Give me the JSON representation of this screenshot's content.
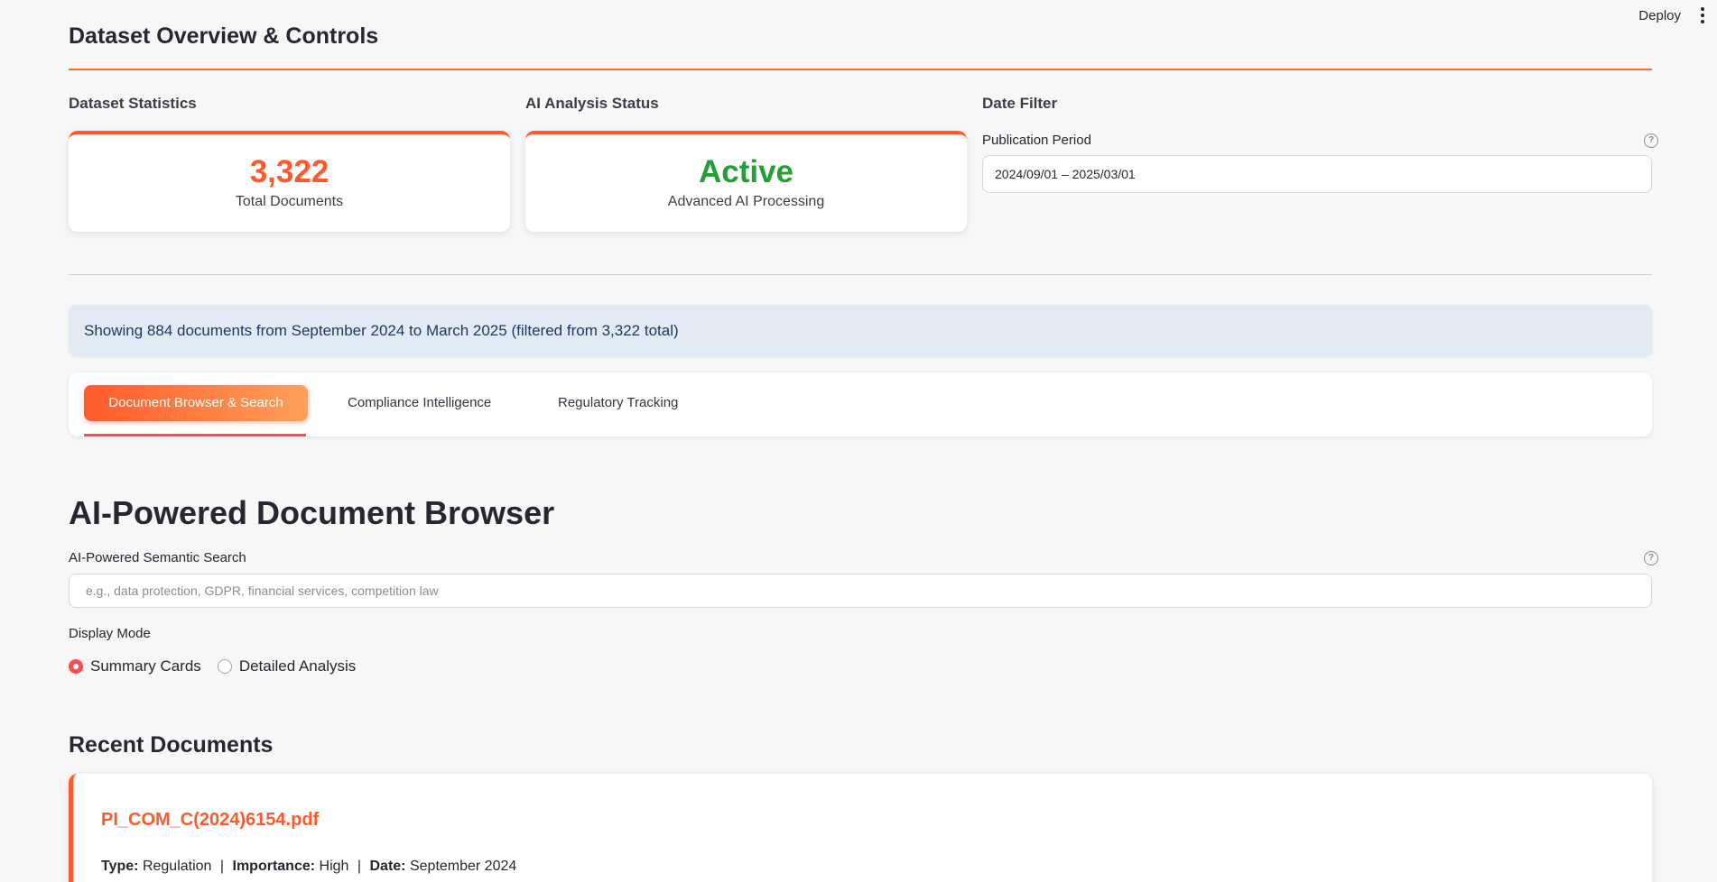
{
  "toolbar": {
    "deploy_label": "Deploy",
    "menu_icon": "kebab-menu-icon"
  },
  "header": {
    "title": "Dataset Overview & Controls"
  },
  "stats": {
    "heading": "Dataset Statistics",
    "value": "3,322",
    "label": "Total Documents"
  },
  "ai_status": {
    "heading": "AI Analysis Status",
    "value": "Active",
    "label": "Advanced AI Processing"
  },
  "date_filter": {
    "heading": "Date Filter",
    "field_label": "Publication Period",
    "value": "2024/09/01 – 2025/03/01",
    "help_icon": "help-icon"
  },
  "info_banner": {
    "text": "Showing 884 documents from September 2024 to March 2025 (filtered from 3,322 total)"
  },
  "tabs": [
    {
      "label": "Document Browser & Search",
      "active": true
    },
    {
      "label": "Compliance Intelligence",
      "active": false
    },
    {
      "label": "Regulatory Tracking",
      "active": false
    }
  ],
  "browser": {
    "title": "AI-Powered Document Browser",
    "search_label": "AI-Powered Semantic Search",
    "search_placeholder": "e.g., data protection, GDPR, financial services, competition law",
    "search_value": "",
    "display_mode_label": "Display Mode",
    "display_modes": [
      {
        "label": "Summary Cards",
        "selected": true
      },
      {
        "label": "Detailed Analysis",
        "selected": false
      }
    ]
  },
  "recent": {
    "title": "Recent Documents",
    "documents": [
      {
        "name": "PI_COM_C(2024)6154.pdf",
        "type_label": "Type:",
        "type": "Regulation",
        "importance_label": "Importance:",
        "importance": "High",
        "date_label": "Date:",
        "date": "September 2024"
      }
    ]
  },
  "colors": {
    "accent": "#ff5a2c",
    "active_green": "#22a036",
    "banner_bg": "#e1eaf5",
    "radio_selected": "#ff4b4b"
  }
}
